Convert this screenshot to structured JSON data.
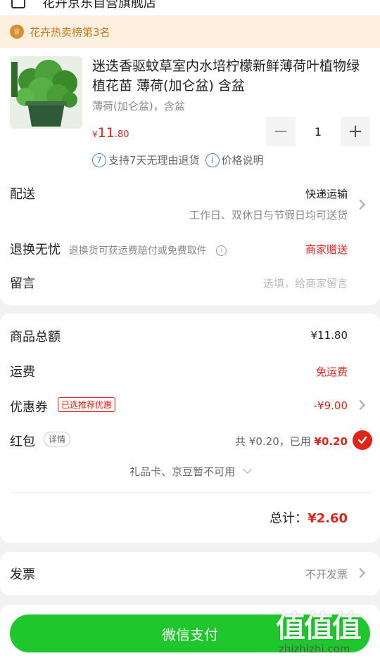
{
  "header": {
    "shop_name": "花卉京东自营旗舰店"
  },
  "rank_banner": {
    "icon": "trophy-icon",
    "text": "花卉热卖榜第3名"
  },
  "product": {
    "title": "迷迭香驱蚊草室内水培柠檬新鲜薄荷叶植物绿植花苗 薄荷(加仑盆) 含盆",
    "spec": "薄荷(加仑盆)，含盆",
    "price_symbol": "¥",
    "price_int": "11",
    "price_dec": ".80",
    "quantity": "1",
    "minus_label": "−",
    "plus_label": "+",
    "return_badge": "7",
    "return_text": "支持7天无理由退货",
    "price_info_badge": "i",
    "price_info_text": "价格说明"
  },
  "delivery": {
    "label": "配送",
    "method": "快递运输",
    "note": "工作日、双休日与节假日均可送货"
  },
  "returns": {
    "label": "退换无忧",
    "desc": "退换货可获运费赔付或免费取件",
    "value": "商家赠送"
  },
  "message": {
    "label": "留言",
    "placeholder": "选填，给商家留言"
  },
  "summary": {
    "subtotal_label": "商品总额",
    "subtotal_value": "¥11.80",
    "shipping_label": "运费",
    "shipping_value": "免运费",
    "coupon_label": "优惠券",
    "coupon_tag": "已选推荐优惠",
    "coupon_value": "-¥9.00",
    "redpacket_label": "红包",
    "redpacket_detail": "详情",
    "redpacket_info": "共 ¥0.20，已用",
    "redpacket_used": "¥0.20",
    "gift_note": "礼品卡、京豆暂不可用",
    "total_label": "总计：",
    "total_value": "¥2.60"
  },
  "invoice": {
    "label": "发票",
    "value": "不开发票"
  },
  "pay_button": {
    "label": "微信支付"
  },
  "watermark": {
    "logo_text": "值值值",
    "domain": "zhizhizhi.com"
  },
  "colors": {
    "accent_red": "#e2231a",
    "pay_green": "#1ec82c",
    "rank_bg": "#fdf0e0",
    "rank_text": "#c8791e",
    "info_blue": "#3c8de6"
  }
}
